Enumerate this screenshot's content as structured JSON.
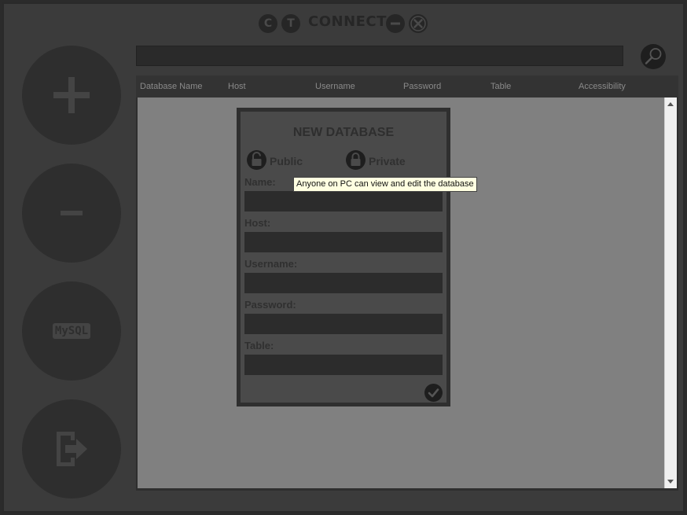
{
  "titlebar": {
    "left_buttons": [
      "C",
      "T"
    ],
    "title": "CONNECT"
  },
  "sidebar": {
    "buttons": [
      {
        "name": "add",
        "icon": "plus-icon"
      },
      {
        "name": "remove",
        "icon": "minus-icon"
      },
      {
        "name": "mysql",
        "icon": "mysql-icon",
        "label": "MySQL"
      },
      {
        "name": "exit",
        "icon": "exit-door-icon"
      }
    ]
  },
  "search": {
    "value": "",
    "placeholder": "",
    "icon": "search-icon"
  },
  "table": {
    "columns": [
      "Database Name",
      "Host",
      "Username",
      "Password",
      "Table",
      "Accessibility"
    ],
    "rows": []
  },
  "dialog": {
    "title": "NEW DATABASE",
    "options": {
      "public_label": "Public",
      "private_label": "Private"
    },
    "fields": {
      "name_label": "Name:",
      "host_label": "Host:",
      "username_label": "Username:",
      "password_label": "Password:",
      "table_label": "Table:"
    }
  },
  "tooltip": {
    "text": "Anyone on PC can view and edit the database"
  },
  "colors": {
    "window_bg": "#3b3b3b",
    "dialog_bg": "#4a4a4a",
    "table_body": "#808080",
    "tooltip_bg": "#ffffe1"
  }
}
